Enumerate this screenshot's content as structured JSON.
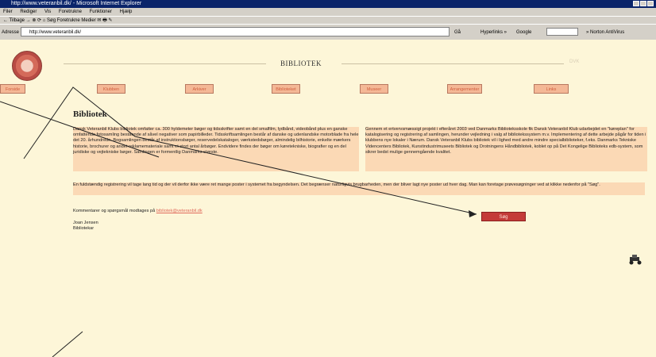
{
  "window": {
    "title": "http://www.veteranbil.dk/ - Microsoft Internet Explorer"
  },
  "menubar": {
    "items": [
      "Filer",
      "Rediger",
      "Vis",
      "Foretrukne",
      "Funktioner",
      "Hjælp"
    ]
  },
  "toolbar": {
    "text": "← Tilbage  →  ⊗  ⟳  ⌂   Søg   Foretrukne   Medier   ✉   🖶   ✎"
  },
  "addressbar": {
    "label": "Adresse",
    "url": "http://www.veteranbil.dk/",
    "go_label": "Gå",
    "links_label": "Hyperlinks »",
    "google_label": "Google",
    "norton_label": "» Norton AntiVirus"
  },
  "header": {
    "title": "BIBLIOTEK",
    "right_mark": "DVK"
  },
  "nav": {
    "items": [
      "Forside",
      "Klubben",
      "Arkiver",
      "Biblioteket",
      "Museer",
      "Arrangementer",
      "Links"
    ]
  },
  "page": {
    "heading": "Bibliotek",
    "para1": "Dansk Veteranbil Klubs bibliotek omfatter ca. 300 hyldemeter bøger og tidsskrifter samt en del smalfilm, lydbånd, videobånd plus en ganske omfattende fotosamling bestående af såvel negativer som papirbilleder. Tidsskriftsamlingen består af danske og udenlandske motorblade fra hele det 20. århundrede. Bogsamlingen består af instruktionsbøger, reservedelskataloger, værkstedsbøger, almindelig bilhistorie, enkelte mærkers historie, brochurer og andet reklamemateriale samt et stort antal årbøger. Endvidere findes der bøger om køretekniske, biografier og en del juridiske og vejtekniske bøger. Samlingen er formentlig Danmarks største.",
    "para2": "Gennem et ertvervsmæssigt projekt i efteråret 2003 ved Danmarks Biblioteksskole fik Dansk Veteranbil Klub udarbejdet en \"køreplan\" for katalogisering og registrering af samlingen, herunder vejledning i valg af bibliotekssystem m.v. Implementering af dette arbejde pågår for tiden i klubbens nye lokaler i Nærum. Dansk Veteranbil Klubs bibliotek vil i lighed med andre mindre specialbiblioteker, f.eks. Danmarks Tekniske Videncenters Bibliotek, Kunstindustrimuseets Bibliotek og Drotningens Håndbibliotek, koblet op på Det Kongelige Biblioteks edb-system, som sikrer bedst mulige gennemgående kvalitet.",
    "para3": "En fuldstændig registrering vil tage lang tid og der vil derfor ikke være ret mange poster i systemet fra begyndelsen. Det begrænser naturligvis brugbarheden, men der bliver lagt nye poster ud hver dag. Man kan foretage prøvesøgninger ved at klikke nedenfor på \"Søg\".",
    "contact_text": "Kommentarer og spørgsmål modtages på",
    "contact_email": "bibliotek@veteranbil.dk",
    "name": "Joan Jensen",
    "role": "Bibliotekar",
    "search_label": "Søg"
  }
}
